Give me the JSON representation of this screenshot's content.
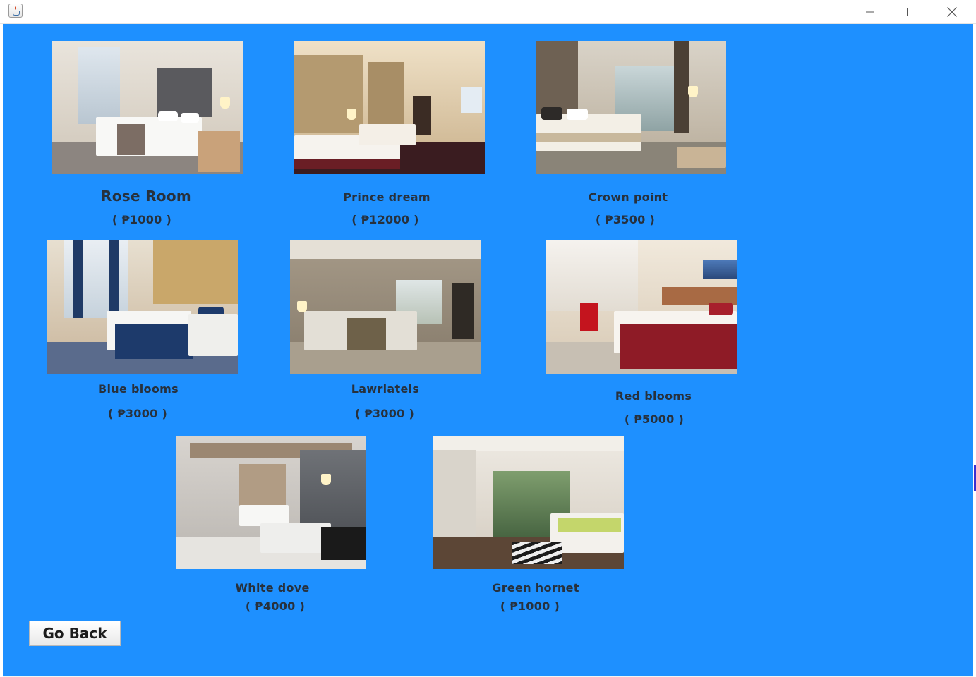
{
  "window": {
    "icon": "java-app-icon",
    "controls": [
      "minimize-icon",
      "maximize-icon",
      "close-icon"
    ]
  },
  "theme": {
    "background": "#1e90ff",
    "text": "#27313d"
  },
  "rooms": [
    {
      "name": "Rose Room",
      "price": "( ₱1000 )"
    },
    {
      "name": "Prince dream",
      "price": "( ₱12000 )"
    },
    {
      "name": "Crown point",
      "price": "( ₱3500 )"
    },
    {
      "name": "Blue blooms",
      "price": "( ₱3000 )"
    },
    {
      "name": "Lawriatels",
      "price": "( ₱3000 )"
    },
    {
      "name": "Red blooms",
      "price": "( ₱5000 )"
    },
    {
      "name": "White dove",
      "price": "( ₱4000 )"
    },
    {
      "name": "Green hornet",
      "price": "( ₱1000 )"
    }
  ],
  "go_back_label": "Go Back"
}
